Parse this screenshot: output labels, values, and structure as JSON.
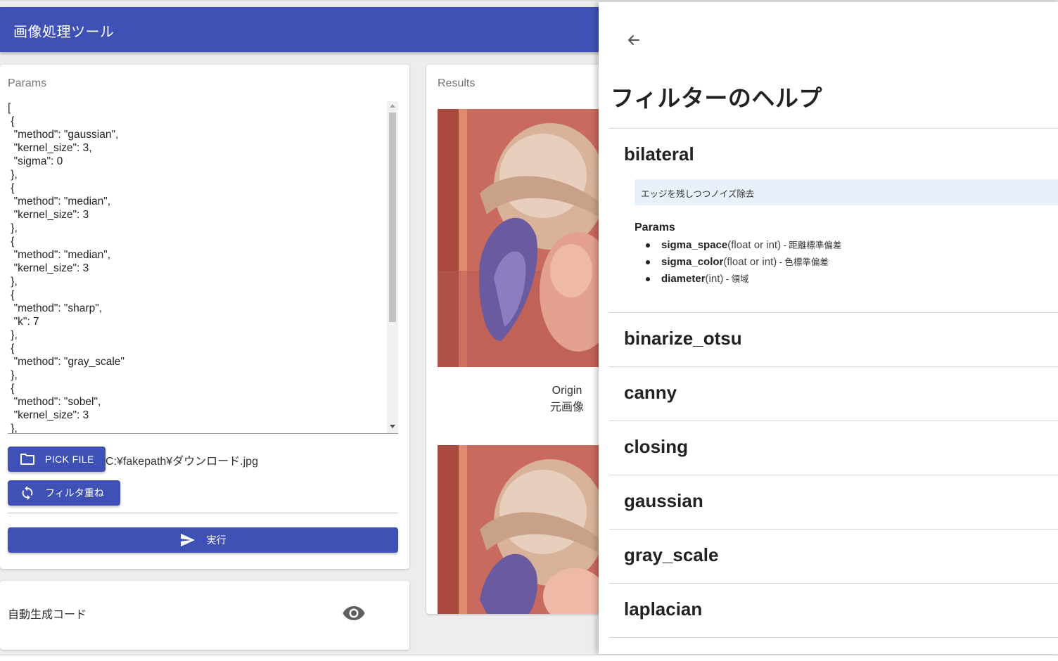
{
  "appbar": {
    "title": "画像処理ツール"
  },
  "params_card": {
    "label": "Params",
    "json_text": "[\n {\n  \"method\": \"gaussian\",\n  \"kernel_size\": 3,\n  \"sigma\": 0\n },\n {\n  \"method\": \"median\",\n  \"kernel_size\": 3\n },\n {\n  \"method\": \"median\",\n  \"kernel_size\": 3\n },\n {\n  \"method\": \"sharp\",\n  \"k\": 7\n },\n {\n  \"method\": \"gray_scale\"\n },\n {\n  \"method\": \"sobel\",\n  \"kernel_size\": 3\n },",
    "pick_file_label": "PICK FILE",
    "file_path": "C:¥fakepath¥ダウンロード.jpg",
    "filter_stack_label": "フィルタ重ね",
    "run_label": "実行"
  },
  "code_card": {
    "label": "自動生成コード",
    "icon": "eye-icon"
  },
  "results_card": {
    "label": "Results",
    "items": [
      {
        "caption_en": "Origin",
        "caption_ja": "元画像"
      }
    ]
  },
  "help_drawer": {
    "title": "フィルターのヘルプ",
    "back_icon": "arrow-left-icon",
    "expanded": {
      "name": "bilateral",
      "description": "エッジを残しつつノイズ除去",
      "params_title": "Params",
      "params": [
        {
          "name": "sigma_space",
          "type": "(float or int)",
          "desc": " - 距離標準偏差"
        },
        {
          "name": "sigma_color",
          "type": "(float or int)",
          "desc": " - 色標準偏差"
        },
        {
          "name": "diameter",
          "type": "(int)",
          "desc": " - 領域"
        }
      ]
    },
    "filters": [
      "binarize_otsu",
      "canny",
      "closing",
      "gaussian",
      "gray_scale",
      "laplacian"
    ]
  },
  "colors": {
    "primary": "#3f51b5",
    "background": "#ededed",
    "info_box": "#e8f1fa"
  }
}
